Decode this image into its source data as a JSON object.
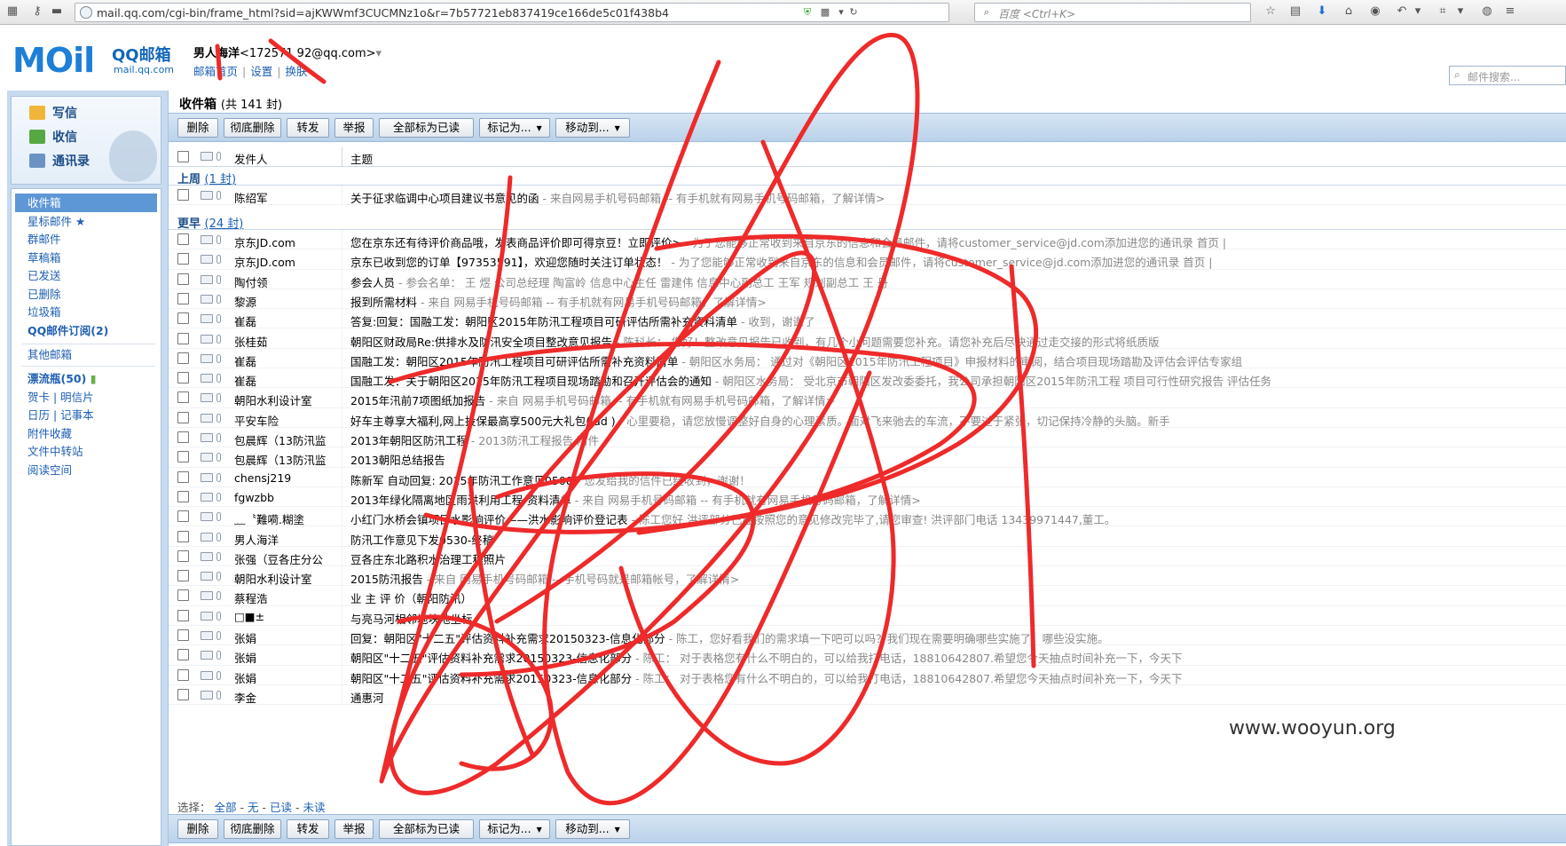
{
  "browser": {
    "url": "mail.qq.com/cgi-bin/frame_html?sid=ajKWWmf3CUCMNz1o&r=7b57721eb837419ce166de5c01f438b4",
    "search_placeholder": "百度 <Ctrl+K>"
  },
  "header": {
    "logo_text": "MOil",
    "logo_cn": "QQ邮箱",
    "logo_domain": "mail.qq.com",
    "user_name": "男人海洋",
    "user_email": "<172571 92@qq.com>",
    "user_dropdown": "▾",
    "links": [
      "邮箱首页",
      "设置",
      "换肤"
    ],
    "search_placeholder": "邮件搜索..."
  },
  "sidebar": {
    "quick": [
      "写信",
      "收信",
      "通讯录"
    ],
    "folders": [
      {
        "label": "收件箱",
        "active": true
      },
      {
        "label": "星标邮件 ★"
      },
      {
        "label": "群邮件"
      },
      {
        "label": "草稿箱"
      },
      {
        "label": "已发送"
      },
      {
        "label": "已删除"
      },
      {
        "label": "垃圾箱"
      },
      {
        "label": "QQ邮件订阅(2)",
        "bold": true
      }
    ],
    "other_mailbox": "其他邮箱",
    "bottle": "漂流瓶(50)",
    "extras": [
      "贺卡 | 明信片",
      "日历 | 记事本",
      "附件收藏",
      "文件中转站",
      "阅读空间"
    ]
  },
  "list": {
    "title": "收件箱",
    "count": "(共 141 封)",
    "toolbar": [
      {
        "label": "删除"
      },
      {
        "label": "彻底删除"
      },
      {
        "label": "转发"
      },
      {
        "label": "举报"
      },
      {
        "label": "全部标为已读"
      },
      {
        "label": "标记为...",
        "dropdown": true
      },
      {
        "label": "移动到...",
        "dropdown": true
      }
    ],
    "col_sender": "发件人",
    "col_subject": "主题",
    "groups": [
      {
        "label": "上周",
        "count": "(1 封)"
      },
      {
        "label": "更早",
        "count": "(24 封)"
      }
    ],
    "rows": [
      {
        "sender": "陈绍军",
        "subject": "关于征求临调中心项目建议书意见的函",
        "preview": " - 来自网易手机号码邮箱 -- 有手机就有网易手机号码邮箱，了解详情>"
      },
      {
        "sender": "京东JD.com",
        "subject": "您在京东还有待评价商品哦，发表商品评价即可得京豆！立即评价>",
        "preview": " - 为了您能够正常收到来自京东的信息和会员邮件，请将customer_service@jd.com添加进您的通讯录 首页 |"
      },
      {
        "sender": "京东JD.com",
        "subject": "京东已收到您的订单【97353591】，欢迎您随时关注订单状态！",
        "preview": " - 为了您能够正常收到来自京东的信息和会员邮件，请将customer_service@jd.com添加进您的通讯录 首页 |"
      },
      {
        "sender": "陶付领",
        "subject": "参会人员",
        "preview": " - 参会名单： 王  煜 公司总经理 陶富岭 信息中心主任 雷建伟 信息中心副总工 王军 规划副总工 王 丹"
      },
      {
        "sender": "黎源",
        "subject": "报到所需材料",
        "preview": " - 来自 网易手机号码邮箱 -- 有手机就有网易手机号码邮箱，了解详情>"
      },
      {
        "sender": "崔磊",
        "subject": "答复:回复：国融工发：朝阳区2015年防汛工程项目可研评估所需补充资料清单",
        "preview": " - 收到，谢谢了"
      },
      {
        "sender": "张桂茹",
        "subject": "朝阳区财政局Re:供排水及防汛安全项目整改意见报告",
        "preview": " - 陈科长： 您好！整改意见报告已收到，有几个小问题需要您补充。请您补充后尽快通过走交接的形式将纸质版"
      },
      {
        "sender": "崔磊",
        "subject": "国融工发：朝阳区2015年防汛工程项目可研评估所需补充资料清单",
        "preview": " - 朝阳区水务局： 通过对《朝阳区2015年防汛工程项目》申报材料的审阅，结合项目现场踏勘及评估会评估专家组"
      },
      {
        "sender": "崔磊",
        "subject": "国融工发：关于朝阳区2015年防汛工程项目现场踏勘和召开评估会的通知",
        "preview": " - 朝阳区水务局： 受北京市朝阳区发改委委托，我公司承担朝阳区2015年防汛工程 项目可行性研究报告 评估任务"
      },
      {
        "sender": "朝阳水利设计室",
        "subject": "2015年汛前7项图纸加报告",
        "preview": " - 来自 网易手机号码邮箱 -- 有手机就有网易手机号码邮箱，了解详情>"
      },
      {
        "sender": "平安车险",
        "subject": "好车主尊享大福利,网上投保最高享500元大礼包( ad )",
        "preview": " - 心里要稳，请您放慢调整好自身的心理素质。面对飞来驰去的车流，不要过于紧张，切记保持冷静的头脑。新手"
      },
      {
        "sender": "包晨辉（13防汛监",
        "subject": "2013年朝阳区防汛工程",
        "preview": " - 2013防汛工程报告 附件"
      },
      {
        "sender": "包晨辉（13防汛监",
        "subject": "2013朝阳总结报告",
        "preview": ""
      },
      {
        "sender": "chensj219",
        "subject": "陈新军 自动回复: 2015年防汛工作意见0508",
        "preview": " - 您发给我的信件已经收到，谢谢！"
      },
      {
        "sender": "fgwzbb",
        "subject": "2013年绿化隔离地区雨洪利用工程-资料清单",
        "preview": " - 来自 网易手机号码邮箱 -- 有手机就有网易手机号码邮箱，了解详情>"
      },
      {
        "sender": "﹏〝難嗬.糊塗",
        "subject": "小红门水桥会镇项目水影响评价——洪水影响评价登记表",
        "preview": " - 陈工您好  洪评部分已经按照您的意见修改完毕了,请您审查!  洪评部门电话 13439971447,董工。"
      },
      {
        "sender": "男人海洋",
        "subject": "防汛工作意见下发0530-终稿",
        "preview": ""
      },
      {
        "sender": "张强（豆各庄分公",
        "subject": "豆各庄东北路积水治理工程照片",
        "preview": ""
      },
      {
        "sender": "朝阳水利设计室",
        "subject": "2015防汛报告",
        "preview": " - 来自 网易手机号码邮箱 -- 手机号码就是邮箱帐号，了解详情>"
      },
      {
        "sender": "蔡程浩",
        "subject": "业 主 评 价（朝阳防汛）",
        "preview": ""
      },
      {
        "sender": "□■±",
        "subject": "与亮马河相邻地块地坐标",
        "preview": ""
      },
      {
        "sender": "张娟",
        "subject": "回复：朝阳区\"十二五\"评估资料补充需求20150323-信息化部分",
        "preview": " - 陈工，您好看我们的需求填一下吧可以吗？我们现在需要明确哪些实施了，哪些没实施。"
      },
      {
        "sender": "张娟",
        "subject": "朝阳区\"十二五\"评估资料补充需求20150323-信息化部分",
        "preview": " - 陈工：   对于表格您有什么不明白的，可以给我打电话，18810642807.希望您今天抽点时间补充一下，今天下"
      },
      {
        "sender": "张娟",
        "subject": "朝阳区\"十二五\"评估资料补充需求20150323-信息化部分",
        "preview": " - 陈工：   对于表格您有什么不明白的，可以给我打电话，18810642807.希望您今天抽点时间补充一下，今天下"
      },
      {
        "sender": "李金",
        "subject": "通惠河",
        "preview": ""
      }
    ],
    "select_label": "选择：",
    "select_options": [
      "全部",
      "无",
      "已读",
      "未读"
    ]
  },
  "watermark": "www.wooyun.org",
  "colors": {
    "brand": "#1e7fd6",
    "frame_bg": "#c7daee",
    "scribble": "#ee2a2a",
    "link": "#1e5fb3"
  }
}
